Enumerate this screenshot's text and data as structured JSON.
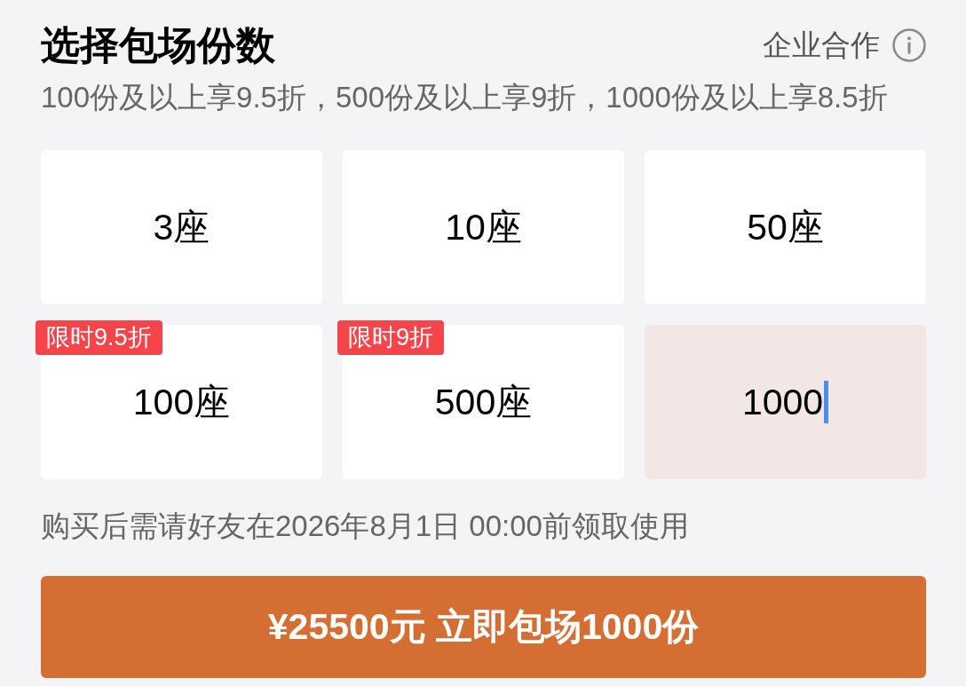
{
  "header": {
    "title": "选择包场份数",
    "enterprise_link": "企业合作",
    "subtitle": "100份及以上享9.5折，500份及以上享9折，1000份及以上享8.5折"
  },
  "options": [
    {
      "kind": "preset",
      "label": "3座",
      "selected": false
    },
    {
      "kind": "preset",
      "label": "10座",
      "selected": false
    },
    {
      "kind": "preset",
      "label": "50座",
      "selected": false
    },
    {
      "kind": "preset",
      "label": "100座",
      "badge": "限时9.5折",
      "selected": false
    },
    {
      "kind": "preset",
      "label": "500座",
      "badge": "限时9折",
      "selected": false
    },
    {
      "kind": "custom",
      "value": "1000",
      "selected": true
    }
  ],
  "note": "购买后需请好友在2026年8月1日 00:00前领取使用",
  "submit_button": "¥25500元 立即包场1000份"
}
